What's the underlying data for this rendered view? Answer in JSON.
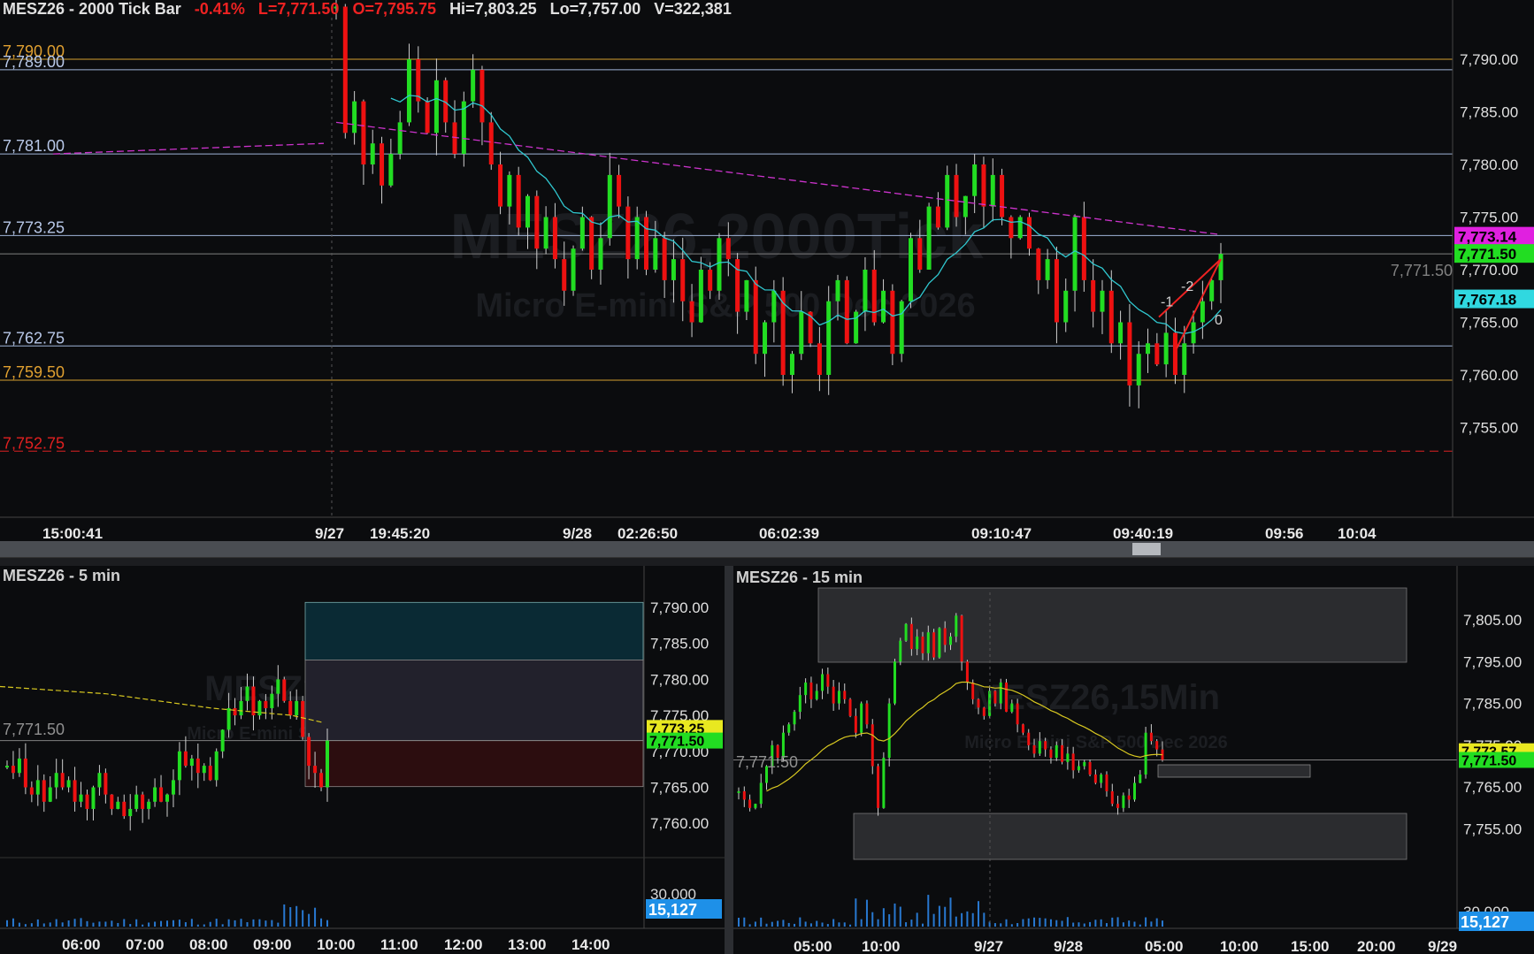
{
  "main_chart": {
    "symbol_title": "MESZ26 - 2000 Tick Bar",
    "change": "-0.41%",
    "last": "L=7,771.50",
    "open": "O=7,795.75",
    "high": "Hi=7,803.25",
    "low": "Lo=7,757.00",
    "volume": "V=322,381",
    "watermark_title": "MESZ26,2000Tick",
    "watermark_sub": "Micro E-mini S&P 500 Dec 2026",
    "level_labels": [
      {
        "text": "7,790.00",
        "price": 7790.0,
        "color": "#e0a030"
      },
      {
        "text": "7,789.00",
        "price": 7789.0,
        "color": "#b8c8e8"
      },
      {
        "text": "7,781.00",
        "price": 7781.0,
        "color": "#b8c8e8"
      },
      {
        "text": "7,773.25",
        "price": 7773.25,
        "color": "#b8c8e8"
      },
      {
        "text": "7,762.75",
        "price": 7762.75,
        "color": "#b8c8e8"
      },
      {
        "text": "7,759.50",
        "price": 7759.5,
        "color": "#e0a030"
      },
      {
        "text": "7,752.75",
        "price": 7752.75,
        "color": "#e02020"
      }
    ],
    "price_ticks": [
      "7,790.00",
      "7,785.00",
      "7,780.00",
      "7,775.00",
      "7,770.00",
      "7,765.00",
      "7,760.00",
      "7,755.00"
    ],
    "price_tick_values": [
      7790,
      7785,
      7780,
      7775,
      7770,
      7765,
      7760,
      7755
    ],
    "badges": [
      {
        "text": "7,773.14",
        "price": 7773.14,
        "bg": "#e020e0",
        "fg": "#000000"
      },
      {
        "text": "7,771.50",
        "price": 7771.5,
        "bg": "#22dd22",
        "fg": "#000000"
      },
      {
        "text": "7,767.18",
        "price": 7767.18,
        "bg": "#30d8e0",
        "fg": "#000000"
      }
    ],
    "last_price_label": "7,771.50",
    "time_labels": [
      {
        "text": "15:00:41",
        "bold": false
      },
      {
        "text": "9/27",
        "bold": true
      },
      {
        "text": "19:45:20",
        "bold": false
      },
      {
        "text": "9/28",
        "bold": true
      },
      {
        "text": "02:26:50",
        "bold": false
      },
      {
        "text": "06:02:39",
        "bold": false
      },
      {
        "text": "09:10:47",
        "bold": false
      },
      {
        "text": "09:40:19",
        "bold": false
      },
      {
        "text": "09:56",
        "bold": false
      },
      {
        "text": "10:04",
        "bold": false
      }
    ],
    "fib_labels": [
      "-1",
      "-2",
      "0"
    ]
  },
  "chart_5min": {
    "title": "MESZ26 - 5 min",
    "watermark_title": "MESZ26,5Min",
    "watermark_sub": "Micro E-mini S&P 500 Dec 2026",
    "left_price_label": "7,771.50",
    "price_ticks": [
      "7,790.00",
      "7,785.00",
      "7,780.00",
      "7,775.00",
      "7,770.00",
      "7,765.00",
      "7,760.00"
    ],
    "price_tick_values": [
      7790,
      7785,
      7780,
      7775,
      7770,
      7765,
      7760
    ],
    "badges": [
      {
        "text": "7,773.25",
        "price": 7773.25,
        "bg": "#e8e820",
        "fg": "#000000"
      },
      {
        "text": "7,771.50",
        "price": 7771.5,
        "bg": "#22dd22",
        "fg": "#000000"
      }
    ],
    "volume_tick": "30,000",
    "volume_badge": "15,127",
    "time_labels": [
      "06:00",
      "07:00",
      "08:00",
      "09:00",
      "10:00",
      "11:00",
      "12:00",
      "13:00",
      "14:00"
    ]
  },
  "chart_15min": {
    "title": "MESZ26 - 15 min",
    "watermark_title": "MESZ26,15Min",
    "watermark_sub": "Micro E-mini S&P 500 Dec 2026",
    "left_price_label": "7,771.50",
    "price_ticks": [
      "7,805.00",
      "7,795.00",
      "7,785.00",
      "7,775.00",
      "7,765.00",
      "7,755.00"
    ],
    "price_tick_values": [
      7805,
      7795,
      7785,
      7775,
      7765,
      7755
    ],
    "badges": [
      {
        "text": "7,773.57",
        "price": 7773.57,
        "bg": "#e8e820",
        "fg": "#000000"
      },
      {
        "text": "7,771.50",
        "price": 7771.5,
        "bg": "#22dd22",
        "fg": "#000000"
      }
    ],
    "volume_tick": "30,000",
    "volume_badge": "15,127",
    "time_labels": [
      {
        "text": "05:00",
        "bold": false
      },
      {
        "text": "10:00",
        "bold": false
      },
      {
        "text": "9/27",
        "bold": true
      },
      {
        "text": "9/28",
        "bold": true
      },
      {
        "text": "05:00",
        "bold": false
      },
      {
        "text": "10:00",
        "bold": false
      },
      {
        "text": "15:00",
        "bold": false
      },
      {
        "text": "20:00",
        "bold": false
      },
      {
        "text": "9/29",
        "bold": true
      }
    ]
  },
  "colors": {
    "up": "#22dd22",
    "down": "#ee1111",
    "cyan_ma": "#30c8d0",
    "magenta_vwap": "#cc33cc",
    "yellow_ma": "#d8c820",
    "level_gold": "#d4a030",
    "level_blue": "#9fb4d8",
    "level_red": "#dd2222"
  }
}
